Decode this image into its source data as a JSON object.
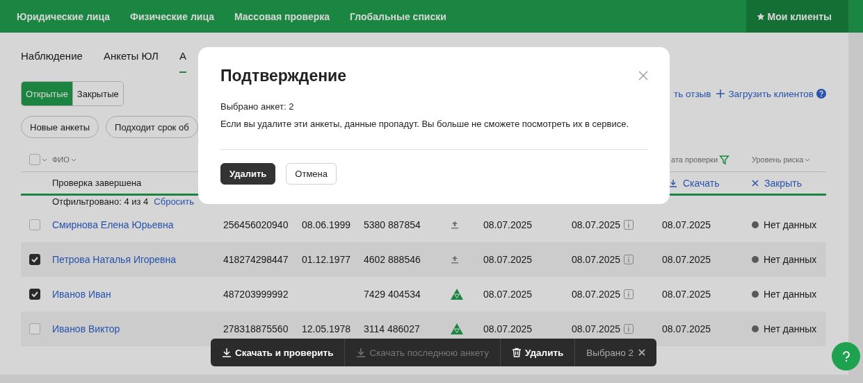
{
  "nav": {
    "items": [
      {
        "label": "Юридические лица"
      },
      {
        "label": "Физические лица"
      },
      {
        "label": "Массовая проверка"
      },
      {
        "label": "Глобальные списки"
      }
    ],
    "my_clients": {
      "label": "Мои клиенты",
      "selected": true
    }
  },
  "tabs": [
    {
      "label": "Наблюдение",
      "selected": false
    },
    {
      "label": "Анкеты ЮЛ",
      "selected": false
    },
    {
      "label": "А",
      "selected": true
    }
  ],
  "segments": [
    {
      "label": "Открытые",
      "selected": true
    },
    {
      "label": "Закрытые",
      "selected": false
    }
  ],
  "chips": [
    {
      "label": "Новые анкеты"
    },
    {
      "label": "Подходит срок об"
    }
  ],
  "links": {
    "feedback": "ть отзыв",
    "upload": "Загрузить клиентов"
  },
  "table": {
    "select_all": {
      "checked": false
    },
    "columns": {
      "name": "ФИО",
      "check_date": "ата проверки",
      "risk": "Уровень риска"
    },
    "subheader": {
      "status": "Проверка завершена",
      "download": "Скачать",
      "close": "Закрыть"
    },
    "filter_note": "Отфильтровано: 4 из 4",
    "reset": "Сбросить",
    "rows": [
      {
        "checked": false,
        "name": "Смирнова Елена Юрьевна",
        "inn": "256456020940",
        "birth": "08.06.1999",
        "passport": "5380 887854",
        "kind": "upload",
        "date_1": "08.07.2025",
        "date_2": "08.07.2025",
        "date_3": "08.07.2025",
        "risk": "Нет данных",
        "color": "#6b6b6b"
      },
      {
        "checked": true,
        "name": "Петрова Наталья Игоревна",
        "inn": "418274298447",
        "birth": "01.12.1977",
        "passport": "4602 888546",
        "kind": "upload",
        "date_1": "08.07.2025",
        "date_2": "08.07.2025",
        "date_3": "08.07.2025",
        "risk": "Нет данных",
        "color": "#6b6b6b"
      },
      {
        "checked": true,
        "name": "Иванов Иван",
        "inn": "487203999992",
        "passport": "7429 404534",
        "kind": "triangle",
        "date_1": "08.07.2025",
        "date_2": "08.07.2025",
        "date_3": "08.07.2025",
        "risk": "Нет данных",
        "color": "#6b6b6b"
      },
      {
        "checked": false,
        "name": "Иванов Виктор",
        "inn": "278318875560",
        "birth": "12.05.1978",
        "passport": "3114 486027",
        "kind": "triangle",
        "date_1": "08.07.2025",
        "date_2": "08.07.2025",
        "date_3": "08.07.2025",
        "risk": "Нет данных",
        "color": "#6b6b6b"
      }
    ]
  },
  "action_bar": {
    "buttons": [
      {
        "kind": "download",
        "label": "Скачать и проверить",
        "disabled": false
      },
      {
        "kind": "download",
        "label": "Скачать последнюю анкету",
        "disabled": true
      },
      {
        "kind": "delete",
        "label": "Удалить",
        "disabled": false
      }
    ],
    "selected_count": "Выбрано 2"
  },
  "modal": {
    "title": "Подтверждение",
    "lines": [
      "Выбрано анкет: 2",
      "Если вы удалите эти анкеты, данные пропадут. Вы больше не сможете посмотреть их в сервисе."
    ],
    "buttons": [
      {
        "kind": "primary",
        "label": "Удалить"
      },
      {
        "kind": "secondary",
        "label": "Отмена"
      }
    ]
  }
}
